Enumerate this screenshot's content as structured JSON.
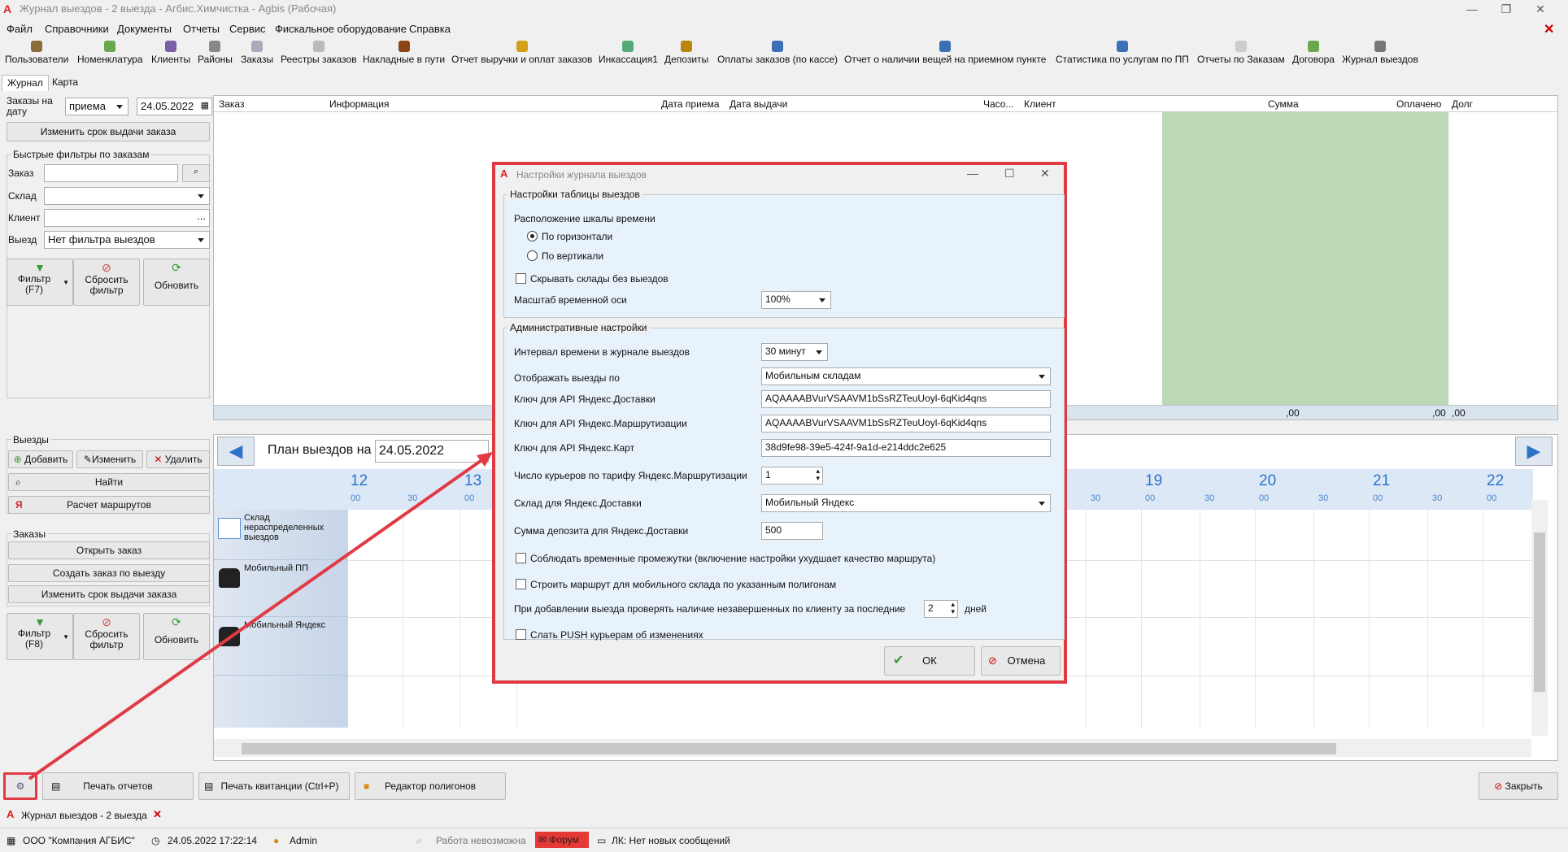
{
  "window": {
    "title": "Журнал выездов - 2 выезда - Агбис.Химчистка - Agbis (Рабочая)",
    "close_app": "✕",
    "min": "—",
    "restore": "❐",
    "close": "✕"
  },
  "menu": [
    "Файл",
    "Справочники",
    "Документы",
    "Отчеты",
    "Сервис",
    "Фискальное оборудование",
    "Справка"
  ],
  "toolbar": [
    "Пользователи",
    "Номенклатура",
    "Клиенты",
    "Районы",
    "Заказы",
    "Реестры заказов",
    "Накладные в пути",
    "Отчет выручки и оплат заказов",
    "Инкассация1",
    "Депозиты",
    "Оплаты заказов (по кассе)",
    "Отчет о наличии вещей на приемном пункте",
    "Статистика по услугам по ПП",
    "Отчеты по Заказам",
    "Договора",
    "Журнал выездов"
  ],
  "tabs": [
    "Журнал",
    "Карта"
  ],
  "left": {
    "date_label": "Заказы на дату",
    "date_type": "приема",
    "date_value": "24.05.2022",
    "change_term": "Изменить срок выдачи заказа",
    "quick_filters": "Быстрые фильтры по заказам",
    "order_label": "Заказ",
    "warehouse_label": "Склад",
    "client_label": "Клиент",
    "trip_label": "Выезд",
    "trip_value": "Нет фильтра выездов",
    "client_dots": "...",
    "filter1": "Фильтр (F7)",
    "reset": "Сбросить фильтр",
    "refresh": "Обновить",
    "trips_group": "Выезды",
    "add": "Добавить",
    "edit": "Изменить",
    "delete": "Удалить",
    "find": "Найти",
    "route_calc": "Расчет маршрутов",
    "orders_group": "Заказы",
    "open_order": "Открыть заказ",
    "create_order": "Создать заказ по выезду",
    "change_term2": "Изменить срок выдачи заказа",
    "filter2": "Фильтр (F8)"
  },
  "grid": {
    "columns": [
      "Заказ",
      "Информация",
      "Дата приема",
      "Дата выдачи",
      "Часо...",
      "Клиент",
      "Сумма",
      "Оплачено",
      "Долг"
    ],
    "totals": [
      ",00",
      ",00",
      ",00"
    ]
  },
  "plan": {
    "label": "План выездов на",
    "date": "24.05.2022",
    "hours": [
      "12",
      "13",
      "19",
      "20",
      "21",
      "22"
    ],
    "mins": [
      "00",
      "30"
    ],
    "rows": [
      "Склад нераспределенных выездов",
      "Мобильный ПП",
      "Мобильный Яндекс"
    ]
  },
  "bottom": {
    "print_reports": "Печать отчетов",
    "print_receipt": "Печать квитанции (Ctrl+P)",
    "polygon_editor": "Редактор полигонов",
    "close": "Закрыть"
  },
  "doc_tab": "Журнал выездов - 2 выезда",
  "status": {
    "company": "ООО \"Компания АГБИС\"",
    "datetime": "24.05.2022 17:22:14",
    "user": "Admin",
    "work": "Работа невозможна",
    "forum": "Форум",
    "lk": "ЛК: Нет новых сообщений"
  },
  "dialog": {
    "title": "Настройки журнала выездов",
    "table_group": "Настройки таблицы выездов",
    "time_scale_pos": "Расположение шкалы времени",
    "horizontal": "По горизонтали",
    "vertical": "По вертикали",
    "hide_empty": "Скрывать склады без выездов",
    "scale_label": "Масштаб временной оси",
    "scale_value": "100%",
    "admin_group": "Административные настройки",
    "interval_label": "Интервал времени в журнале выездов",
    "interval_value": "30 минут",
    "show_by_label": "Отображать выезды по",
    "show_by_value": "Мобильным складам",
    "key_delivery_label": "Ключ для API Яндекс.Доставки",
    "key_delivery": "AQAAAABVurVSAAVM1bSsRZTeuUoyl-6qKid4qns",
    "key_routing_label": "Ключ для API Яндекс.Маршрутизации",
    "key_routing": "AQAAAABVurVSAAVM1bSsRZTeuUoyl-6qKid4qns",
    "key_maps_label": "Ключ для API Яндекс.Карт",
    "key_maps": "38d9fe98-39e5-424f-9a1d-e214ddc2e625",
    "couriers_label": "Число курьеров по тарифу Яндекс.Маршрутизации",
    "couriers": "1",
    "warehouse_label": "Склад для Яндекс.Доставки",
    "warehouse": "Мобильный Яндекс",
    "deposit_label": "Сумма депозита для Яндекс.Доставки",
    "deposit": "500",
    "respect_intervals": "Соблюдать временные промежутки (включение настройки ухудшает качество маршрута)",
    "build_route": "Строить маршрут для мобильного склада по указанным полигонам",
    "check_unfinished": "При добавлении выезда проверять наличие незавершенных по клиенту за последние",
    "days_value": "2",
    "days": "дней",
    "send_push": "Слать PUSH курьерам об изменениях",
    "ok": "ОК",
    "cancel": "Отмена"
  }
}
